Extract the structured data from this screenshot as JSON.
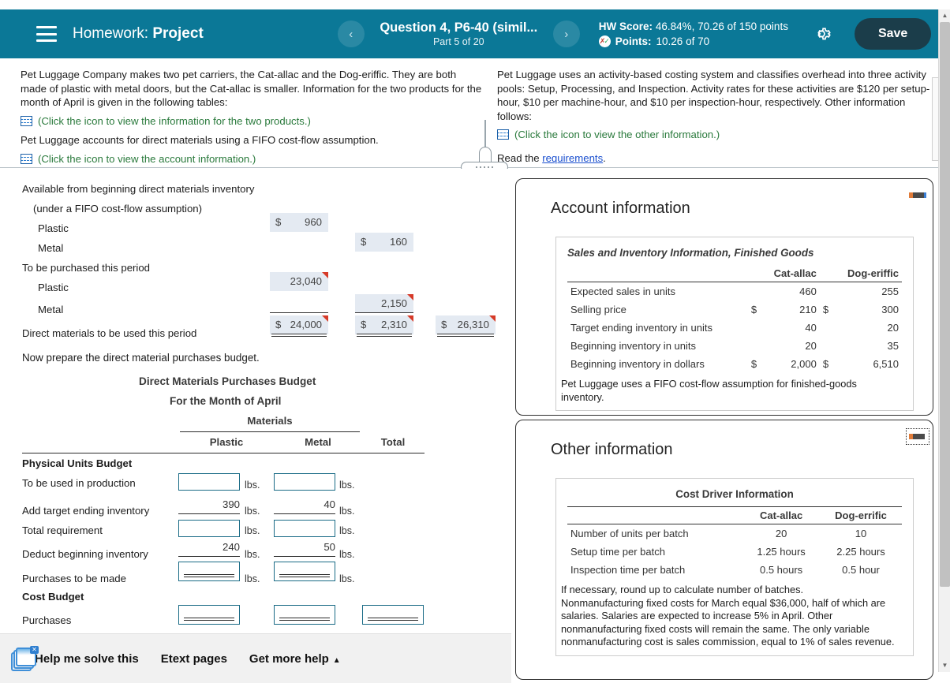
{
  "header": {
    "menu_icon": "hamburger-icon",
    "homework_label": "Homework:",
    "homework_name": "Project",
    "prev_icon": "‹",
    "next_icon": "›",
    "question_title": "Question 4, P6-40 (simil...",
    "question_part": "Part 5 of 20",
    "hw_score_label": "HW Score:",
    "hw_score_value": "46.84%, 70.26 of 150 points",
    "points_label": "Points:",
    "points_value": "10.26 of 70",
    "gear_icon": "gear-icon",
    "save_label": "Save",
    "accent_color": "#0b7897",
    "save_bg": "#1b3d4a"
  },
  "problem": {
    "left_para1": "Pet Luggage Company makes two pet carriers, the Cat-allac and the Dog-eriffic. They are both made of plastic with metal doors, but the Cat-allac is smaller. Information for the two products for the month of April is given in the following tables:",
    "left_link1": "(Click the icon to view the information for the two products.)",
    "left_para2": "Pet Luggage accounts for direct materials using a FIFO cost-flow assumption.",
    "left_link2": "(Click the icon to view the account information.)",
    "right_para1": "Pet Luggage uses an activity-based costing system and classifies overhead into three activity pools: Setup, Processing, and Inspection. Activity rates for these activities are $120 per setup-hour, $10 per machine-hour, and $10 per inspection-hour, respectively. Other information follows:",
    "right_link1": "(Click the icon to view the other information.)",
    "read_the": "Read the",
    "requirements_link": "requirements",
    "period": "."
  },
  "worksheet": {
    "lines": [
      {
        "label": "Available from beginning direct materials inventory",
        "indent": 0
      },
      {
        "label": "(under a FIFO cost-flow assumption)",
        "indent": 1
      },
      {
        "label": "Plastic",
        "indent": 2
      },
      {
        "label": "Metal",
        "indent": 2
      },
      {
        "label": "To be purchased this period",
        "indent": 0
      },
      {
        "label": "Plastic",
        "indent": 2
      },
      {
        "label": "Metal",
        "indent": 2
      },
      {
        "label": "Direct materials to be used this period",
        "indent": 0
      }
    ],
    "cells": {
      "plastic_begin_dollar": "$",
      "plastic_begin": "960",
      "metal_begin_dollar": "$",
      "metal_begin": "160",
      "plastic_purchase": "23,040",
      "metal_purchase": "2,150",
      "plastic_total_dollar": "$",
      "plastic_total": "24,000",
      "metal_total_dollar": "$",
      "metal_total": "2,310",
      "grand_total_dollar": "$",
      "grand_total": "26,310"
    },
    "prompt": "Now prepare the direct material purchases budget.",
    "budget": {
      "title": "Direct Materials Purchases Budget",
      "subtitle": "For the Month of April",
      "group_header": "Materials",
      "columns": [
        "Plastic",
        "Metal",
        "Total"
      ],
      "section1": "Physical Units Budget",
      "section2": "Cost Budget",
      "unit_suffix": "lbs.",
      "rows": [
        {
          "label": "To be used in production",
          "plastic": "",
          "metal": "",
          "type": "input"
        },
        {
          "label": "Add target ending inventory",
          "plastic": "390",
          "metal": "40",
          "type": "given"
        },
        {
          "label": "Total requirement",
          "plastic": "",
          "metal": "",
          "type": "input"
        },
        {
          "label": "Deduct beginning inventory",
          "plastic": "240",
          "metal": "50",
          "type": "given"
        },
        {
          "label": "Purchases to be made",
          "plastic": "",
          "metal": "",
          "type": "input-total"
        },
        {
          "label": "Purchases",
          "plastic": "",
          "metal": "",
          "total": "",
          "type": "cost-total"
        }
      ]
    }
  },
  "account_panel": {
    "title": "Account information",
    "minimize_icon": "minimize-icon",
    "table_title": "Sales and Inventory Information, Finished Goods",
    "columns": [
      "Cat-allac",
      "Dog-eriffic"
    ],
    "rows": [
      {
        "label": "Expected sales in units",
        "cat_dollar": "",
        "cat": "460",
        "dog_dollar": "",
        "dog": "255"
      },
      {
        "label": "Selling price",
        "cat_dollar": "$",
        "cat": "210",
        "dog_dollar": "$",
        "dog": "300"
      },
      {
        "label": "Target ending inventory in units",
        "cat_dollar": "",
        "cat": "40",
        "dog_dollar": "",
        "dog": "20"
      },
      {
        "label": "Beginning inventory in units",
        "cat_dollar": "",
        "cat": "20",
        "dog_dollar": "",
        "dog": "35"
      },
      {
        "label": "Beginning inventory in dollars",
        "cat_dollar": "$",
        "cat": "2,000",
        "dog_dollar": "$",
        "dog": "6,510"
      }
    ],
    "footnote": "Pet Luggage uses a FIFO cost-flow assumption for finished-goods inventory."
  },
  "other_panel": {
    "title": "Other information",
    "minimize_icon": "minimize-icon",
    "table_title": "Cost Driver Information",
    "columns": [
      "Cat-allac",
      "Dog-errific"
    ],
    "rows": [
      {
        "label": "Number of units per batch",
        "cat": "20",
        "dog": "10"
      },
      {
        "label": "Setup time per batch",
        "cat": "1.25 hours",
        "dog": "2.25 hours"
      },
      {
        "label": "Inspection time per batch",
        "cat": "0.5 hours",
        "dog": "0.5 hour"
      }
    ],
    "footnote": "If necessary, round up to calculate number of batches.\nNonmanufacturing fixed costs for March equal $36,000, half of which are salaries. Salaries are expected to increase 5% in April. Other nonmanufacturing fixed costs will remain the same. The only variable nonmanufacturing cost is sales commission, equal to 1% of sales revenue."
  },
  "bottom_bar": {
    "help_icon": "stacked-windows-icon",
    "help_label": "Help me solve this",
    "etext_label": "Etext pages",
    "more_help_label": "Get more help",
    "caret": "▲"
  }
}
